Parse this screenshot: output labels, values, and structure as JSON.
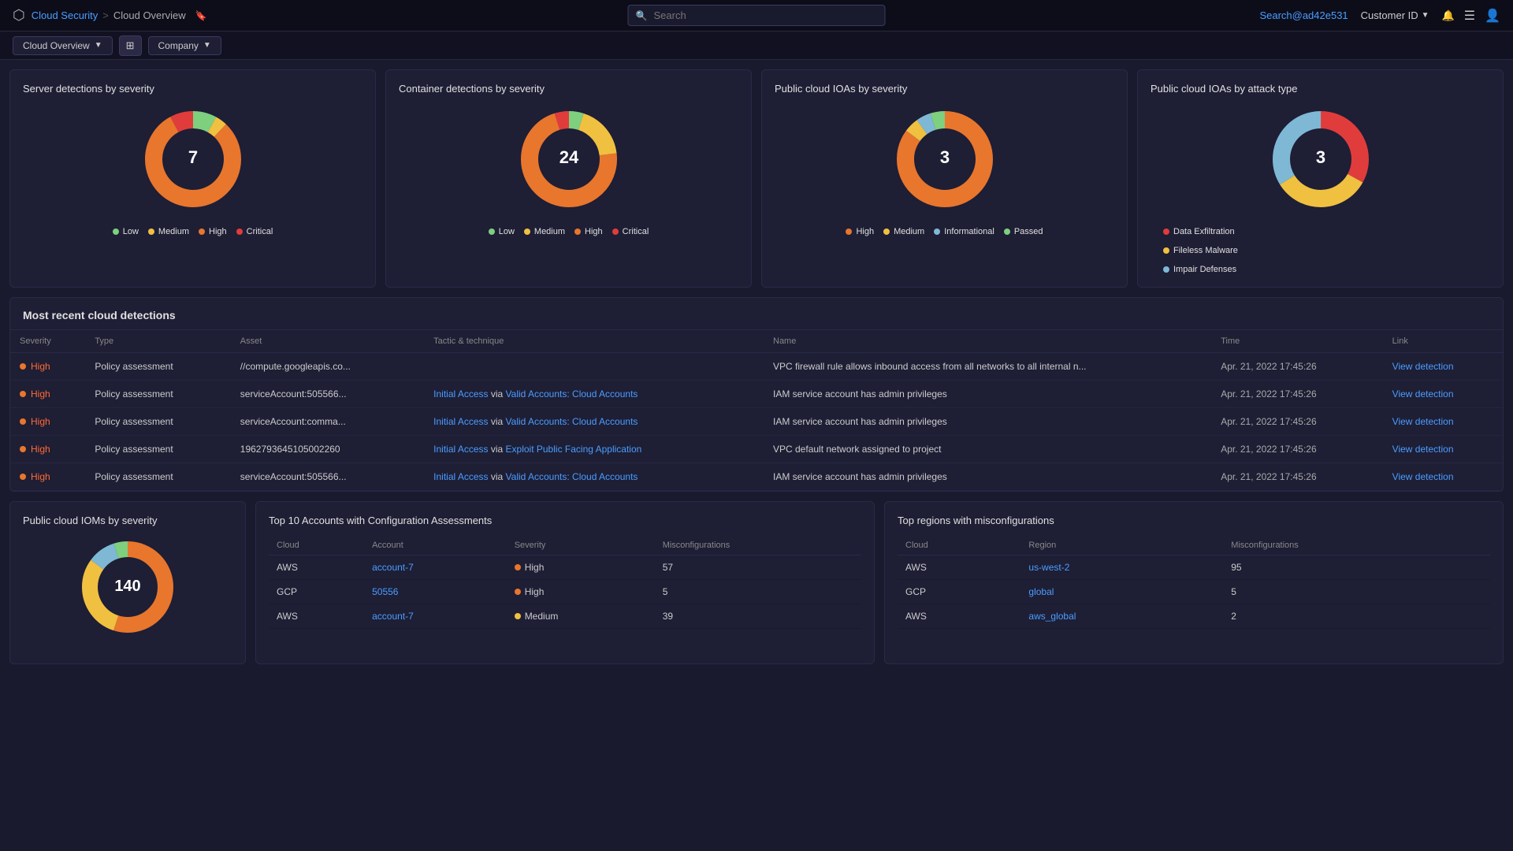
{
  "nav": {
    "logo_icon": "☁",
    "breadcrumb": [
      "Cloud Security",
      ">",
      "Cloud Overview"
    ],
    "bookmark_icon": "🔖",
    "search_placeholder": "Search",
    "user_email": "Search@ad42e531",
    "customer_id_label": "Customer ID",
    "bell_icon": "🔔",
    "menu_icon": "☰",
    "user_icon": "👤"
  },
  "sub_nav": {
    "overview_label": "Cloud Overview",
    "grid_icon": "⊞",
    "company_label": "Company"
  },
  "charts": {
    "server_detections": {
      "title": "Server detections by severity",
      "center_value": "7",
      "legend": [
        {
          "label": "Low",
          "color": "#5cb85c"
        },
        {
          "label": "Medium",
          "color": "#f0c040"
        },
        {
          "label": "High",
          "color": "#e8762c"
        },
        {
          "label": "Critical",
          "color": "#e03c3c"
        }
      ],
      "segments": [
        {
          "pct": 8,
          "color": "#7ecf7e"
        },
        {
          "pct": 4,
          "color": "#f0c040"
        },
        {
          "pct": 80,
          "color": "#e8762c"
        },
        {
          "pct": 8,
          "color": "#e03c3c"
        }
      ]
    },
    "container_detections": {
      "title": "Container detections by severity",
      "center_value": "24",
      "legend": [
        {
          "label": "Low",
          "color": "#5cb85c"
        },
        {
          "label": "Medium",
          "color": "#f0c040"
        },
        {
          "label": "High",
          "color": "#e8762c"
        },
        {
          "label": "Critical",
          "color": "#e03c3c"
        }
      ],
      "segments": [
        {
          "pct": 5,
          "color": "#7ecf7e"
        },
        {
          "pct": 18,
          "color": "#f0c040"
        },
        {
          "pct": 72,
          "color": "#e8762c"
        },
        {
          "pct": 5,
          "color": "#e03c3c"
        }
      ]
    },
    "public_ioas": {
      "title": "Public cloud IOAs by severity",
      "center_value": "3",
      "legend": [
        {
          "label": "High",
          "color": "#e8762c"
        },
        {
          "label": "Medium",
          "color": "#f0c040"
        },
        {
          "label": "Informational",
          "color": "#7eb8d4"
        },
        {
          "label": "Passed",
          "color": "#7ecf7e"
        }
      ],
      "segments": [
        {
          "pct": 85,
          "color": "#e8762c"
        },
        {
          "pct": 5,
          "color": "#f0c040"
        },
        {
          "pct": 5,
          "color": "#7eb8d4"
        },
        {
          "pct": 5,
          "color": "#7ecf7e"
        }
      ]
    },
    "attack_type": {
      "title": "Public cloud IOAs by attack type",
      "center_value": "3",
      "legend": [
        {
          "label": "Data Exfiltration",
          "color": "#e03c3c"
        },
        {
          "label": "Fileless Malware",
          "color": "#f0c040"
        },
        {
          "label": "Impair Defenses",
          "color": "#7eb8d4"
        }
      ],
      "segments": [
        {
          "pct": 33,
          "color": "#e03c3c"
        },
        {
          "pct": 33,
          "color": "#f0c040"
        },
        {
          "pct": 34,
          "color": "#7eb8d4"
        }
      ]
    }
  },
  "detections": {
    "title": "Most recent cloud detections",
    "columns": [
      "Severity",
      "Type",
      "Asset",
      "Tactic & technique",
      "Name",
      "Time",
      "Link"
    ],
    "rows": [
      {
        "severity": "High",
        "type": "Policy assessment",
        "asset": "//compute.googleapis.co...",
        "tactic": "",
        "tactic_links": [],
        "name": "VPC firewall rule allows inbound access from all networks to all internal n...",
        "time": "Apr. 21, 2022 17:45:26",
        "link": "View detection"
      },
      {
        "severity": "High",
        "type": "Policy assessment",
        "asset": "serviceAccount:505566...",
        "tactic": "Initial Access via Valid Accounts: Cloud Accounts",
        "tactic_part1": "Initial Access",
        "tactic_via": " via ",
        "tactic_part2": "Valid Accounts: Cloud Accounts",
        "name": "IAM service account has admin privileges",
        "time": "Apr. 21, 2022 17:45:26",
        "link": "View detection"
      },
      {
        "severity": "High",
        "type": "Policy assessment",
        "asset": "serviceAccount:comma...",
        "tactic": "Initial Access via Valid Accounts: Cloud Accounts",
        "tactic_part1": "Initial Access",
        "tactic_via": " via ",
        "tactic_part2": "Valid Accounts: Cloud Accounts",
        "name": "IAM service account has admin privileges",
        "time": "Apr. 21, 2022 17:45:26",
        "link": "View detection"
      },
      {
        "severity": "High",
        "type": "Policy assessment",
        "asset": "196279364510500­2260",
        "tactic": "Initial Access via Exploit Public Facing Application",
        "tactic_part1": "Initial Access",
        "tactic_via": " via ",
        "tactic_part2": "Exploit Public Facing Application",
        "name": "VPC default network assigned to project",
        "time": "Apr. 21, 2022 17:45:26",
        "link": "View detection"
      },
      {
        "severity": "High",
        "type": "Policy assessment",
        "asset": "serviceAccount:505566...",
        "tactic": "Initial Access via Valid Accounts: Cloud Accounts",
        "tactic_part1": "Initial Access",
        "tactic_via": " via ",
        "tactic_part2": "Valid Accounts: Cloud Accounts",
        "name": "IAM service account has admin privileges",
        "time": "Apr. 21, 2022 17:45:26",
        "link": "View detection"
      }
    ]
  },
  "bottom": {
    "ioms": {
      "title": "Public cloud IOMs by severity",
      "center_value": "140",
      "segments": [
        {
          "pct": 55,
          "color": "#e8762c"
        },
        {
          "pct": 30,
          "color": "#f0c040"
        },
        {
          "pct": 10,
          "color": "#7eb8d4"
        },
        {
          "pct": 5,
          "color": "#7ecf7e"
        }
      ]
    },
    "top_accounts": {
      "title": "Top 10 Accounts with Configuration Assessments",
      "columns": [
        "Cloud",
        "Account",
        "Severity",
        "Misconfigurations"
      ],
      "rows": [
        {
          "cloud": "AWS",
          "account": "account-7",
          "severity": "High",
          "severity_color": "#e8762c",
          "count": "57"
        },
        {
          "cloud": "GCP",
          "account": "50556",
          "severity": "High",
          "severity_color": "#e8762c",
          "count": "5"
        },
        {
          "cloud": "AWS",
          "account": "account-7",
          "severity": "Medium",
          "severity_color": "#f0c040",
          "count": "39"
        }
      ]
    },
    "top_regions": {
      "title": "Top regions with misconfigurations",
      "columns": [
        "Cloud",
        "Region",
        "Misconfigurations"
      ],
      "rows": [
        {
          "cloud": "AWS",
          "region": "us-west-2",
          "count": "95"
        },
        {
          "cloud": "GCP",
          "region": "global",
          "count": "5"
        },
        {
          "cloud": "AWS",
          "region": "aws_global",
          "count": "2"
        }
      ]
    }
  }
}
